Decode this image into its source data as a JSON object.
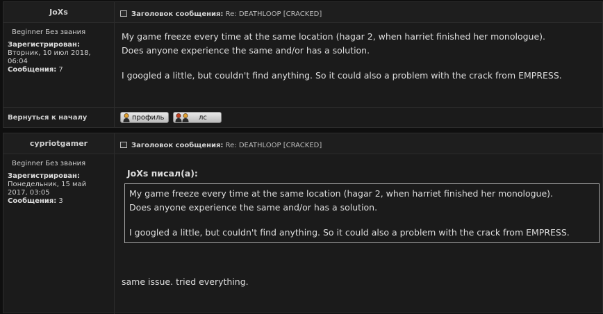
{
  "posts": [
    {
      "author": "JoXs",
      "rank": "Beginner Без звания",
      "registered_label": "Зарегистрирован:",
      "registered_value": "Вторник, 10 июл 2018, 06:04",
      "posts_label": "Сообщения:",
      "posts_value": "7",
      "subject_label": "Заголовок сообщения:",
      "subject_value": "Re: DEATHLOOP [CRACKED]",
      "body_lines": [
        "My game freeze every time at the same location (hagar 2, when harriet finished her monologue).",
        "Does anyone experience the same and/or has a solution.",
        "I googled a little, but couldn't find anything. So it could also a problem with the crack from EMPRESS."
      ]
    },
    {
      "author": "cypriotgamer",
      "rank": "Beginner Без звания",
      "registered_label": "Зарегистрирован:",
      "registered_value": "Понедельник, 15 май 2017, 03:05",
      "posts_label": "Сообщения:",
      "posts_value": "3",
      "subject_label": "Заголовок сообщения:",
      "subject_value": "Re: DEATHLOOP [CRACKED]",
      "quote_title": "JoXs писал(а):",
      "quote_lines": [
        "My game freeze every time at the same location (hagar 2, when harriet finished her monologue).",
        "Does anyone experience the same and/or has a solution.",
        "I googled a little, but couldn't find anything. So it could also a problem with the crack from EMPRESS."
      ],
      "reply": "same issue. tried everything."
    }
  ],
  "footer": {
    "back_to_top": "Вернуться к началу",
    "profile_button": "профиль",
    "pm_button": "лс"
  },
  "icons": {
    "subject_icon": "post-icon",
    "profile_icon": "user-icon",
    "pm_icon": "users-icon"
  },
  "colors": {
    "background": "#0f0f0f",
    "panel": "#1b1b1b",
    "border": "#2c2c2c",
    "text": "#dedede"
  }
}
